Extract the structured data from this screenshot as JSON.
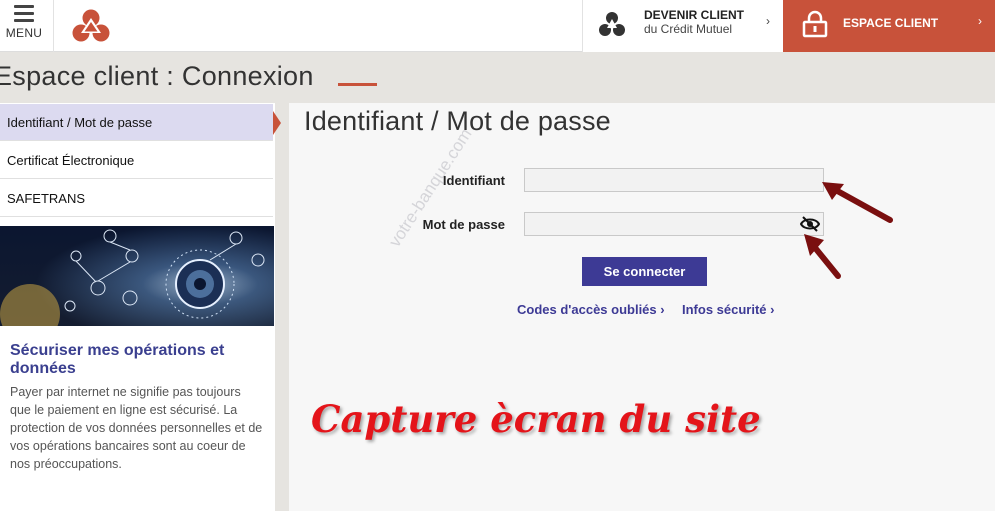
{
  "header": {
    "menu_label": "MENU",
    "devenir_line1": "DEVENIR CLIENT",
    "devenir_line2": "du Crédit Mutuel",
    "devenir_chevron": "›",
    "espace_label": "ESPACE CLIENT",
    "espace_chevron": "›",
    "accent_color": "#c8523a"
  },
  "page": {
    "title": "Espace client : Connexion"
  },
  "sidebar": {
    "items": [
      {
        "label": "Identifiant / Mot de passe",
        "active": true
      },
      {
        "label": "Certificat Électronique",
        "active": false
      },
      {
        "label": "SAFETRANS",
        "active": false
      }
    ],
    "promo_title": "Sécuriser mes opérations et données",
    "promo_text": "Payer par internet ne signifie pas toujours que le paiement en ligne est sécurisé. La protection de vos données personnelles et de vos opérations bancaires sont au coeur de nos préoccupations."
  },
  "form": {
    "title": "Identifiant / Mot de passe",
    "identifiant_label": "Identifiant",
    "identifiant_value": "",
    "password_label": "Mot de passe",
    "password_value": "",
    "submit_label": "Se connecter",
    "link_forgot": "Codes d'accès oubliés ›",
    "link_security": "Infos sécurité ›",
    "button_color": "#3d3a95"
  },
  "overlay": {
    "watermark": "votre-banque.com",
    "caption": "Capture ècran du site",
    "caption_color": "#e4141a"
  },
  "icons": [
    "menu-icon",
    "credit-mutuel-logo",
    "devenir-client-icon",
    "lock-icon",
    "eye-slash-icon"
  ]
}
